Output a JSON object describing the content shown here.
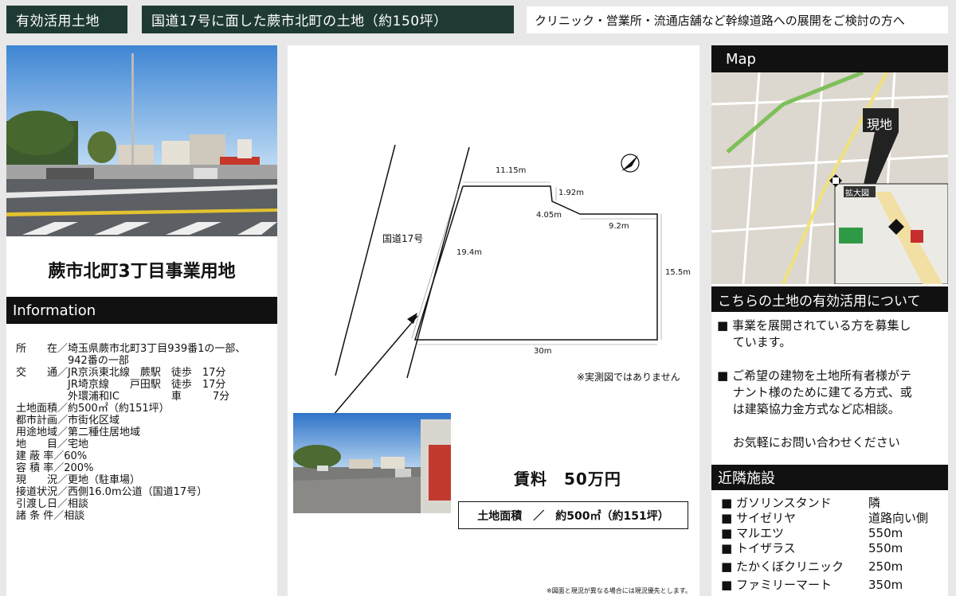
{
  "header": {
    "tag": "有効活用土地",
    "title": "国道17号に面した蕨市北町の土地（約150坪）",
    "subtitle": "クリニック・営業所・流通店舗など幹線道路への展開をご検討の方へ"
  },
  "left": {
    "property_name": "蕨市北町3丁目事業用地",
    "info_heading": "Information",
    "info_lines": [
      "所　　在／埼玉県蕨市北町3丁目939番1の一部、",
      "　　　　　942番の一部",
      "交　　通／JR京浜東北線　蕨駅　徒歩　17分",
      "　　　　　JR埼京線　　戸田駅　徒歩　17分",
      "　　　　　外環浦和IC　　　　　車　　　7分",
      "",
      "土地面積／約500㎡（約151坪）",
      "都市計画／市街化区域",
      "用途地域／第二種住居地域",
      "地　　目／宅地",
      "建 蔽 率／60%",
      "容 積 率／200%",
      "",
      "現　　況／更地（駐車場）",
      "接道状況／西側16.0m公道（国道17号）",
      "",
      "引渡し日／相談",
      "諸 条 件／相談"
    ]
  },
  "plan": {
    "road_label": "国道17号",
    "dims": {
      "top": "11.15m",
      "notch_v": "1.92m",
      "notch_d": "4.05m",
      "right_top": "9.2m",
      "left": "19.4m",
      "right": "15.5m",
      "bottom": "30m"
    },
    "note": "※実測図ではありません",
    "rent_label": "賃料　50万円",
    "area_label": "土地面積　／　約500㎡（約151坪）",
    "footnote": "※図面と現況が異なる場合には現況優先とします。"
  },
  "map": {
    "heading": "Map",
    "site_label": "現地",
    "zoom_label": "拡大図"
  },
  "utilization": {
    "heading": "こちらの土地の有効活用について",
    "lines": [
      "■ 事業を展開されている方を募集し",
      "　 ています。",
      "",
      "■ ご希望の建物を土地所有者様がテ",
      "　 ナント様のために建てる方式、或",
      "　 は建築協力金方式など応相談。",
      "",
      "　 お気軽にお問い合わせください"
    ]
  },
  "nearby": {
    "heading": "近隣施設",
    "items": [
      {
        "name": "■ ガソリンスタンド",
        "dist": "隣"
      },
      {
        "name": "■ サイゼリヤ",
        "dist": "道路向い側"
      },
      {
        "name": "■ マルエツ",
        "dist": "550m"
      },
      {
        "name": "■ トイザラス",
        "dist": "550m"
      },
      {
        "name": "■ たかくぼクリニック",
        "dist": "250m"
      },
      {
        "name": "■ ファミリーマート",
        "dist": "350m"
      }
    ]
  }
}
